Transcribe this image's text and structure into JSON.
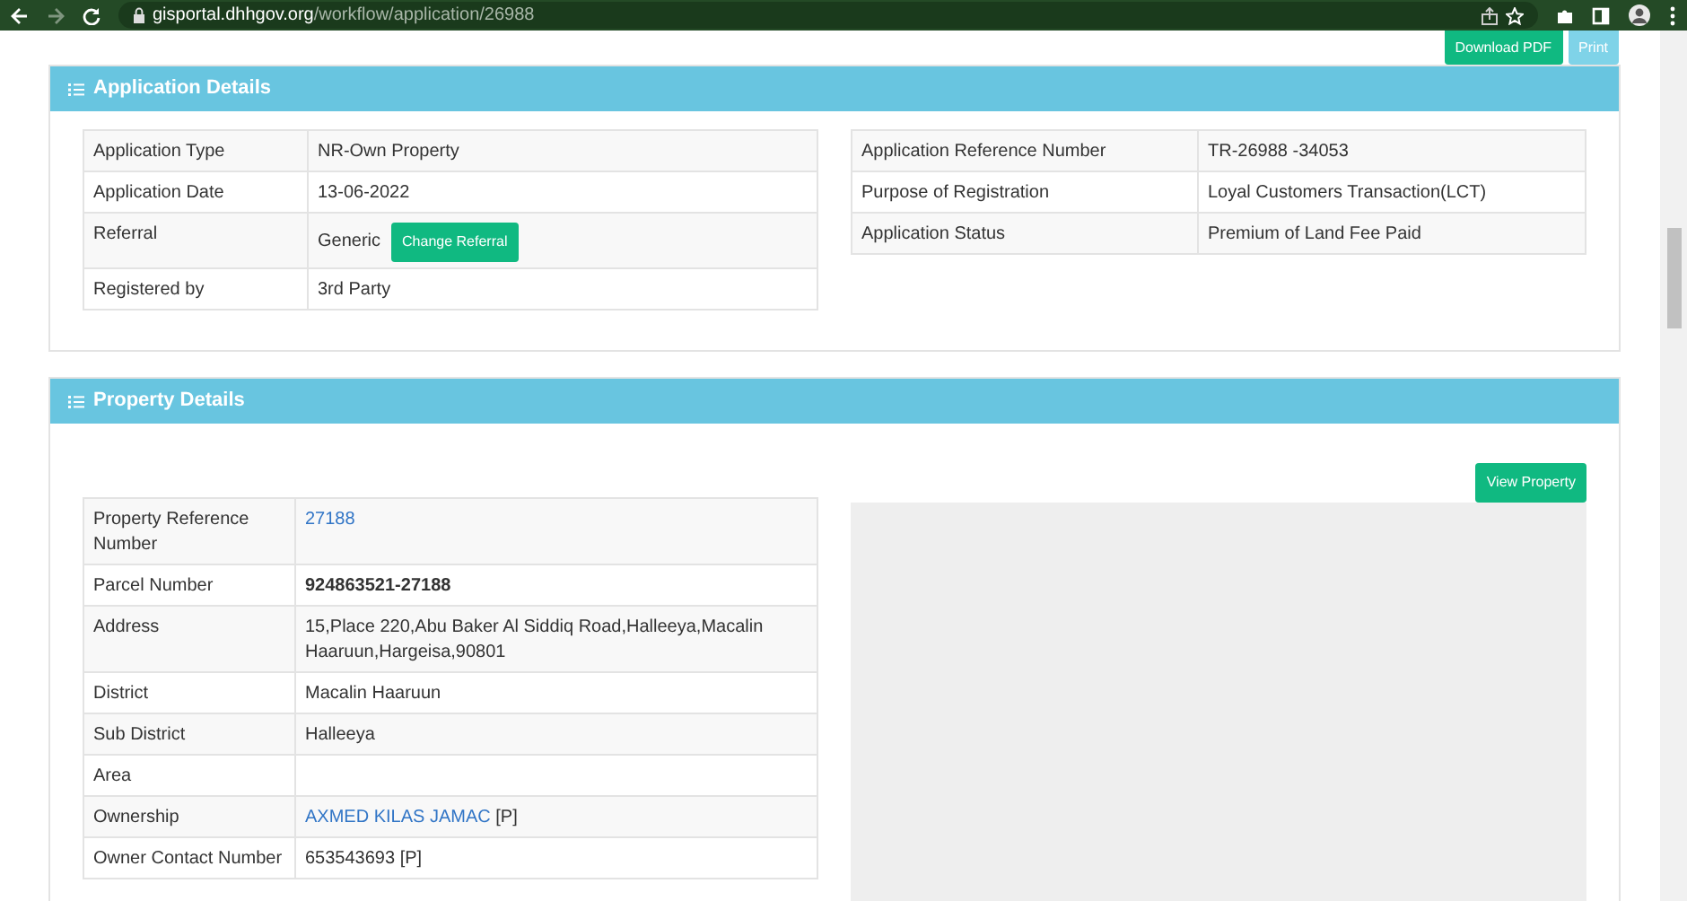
{
  "browser": {
    "url_host": "gisportal.dhhgov.org",
    "url_path": "/workflow/application/26988",
    "forward_disabled": true
  },
  "top_buttons": [
    {
      "label": "Download PDF",
      "kind": "success"
    },
    {
      "label": "Print",
      "kind": "info"
    }
  ],
  "application_details": {
    "title": "Application Details",
    "left_rows": [
      {
        "label": "Application Type",
        "value": "NR-Own Property"
      },
      {
        "label": "Application Date",
        "value": "13-06-2022"
      },
      {
        "label": "Referral",
        "value": "Generic",
        "button": "Change Referral"
      },
      {
        "label": "Registered by",
        "value": "3rd Party"
      }
    ],
    "right_rows": [
      {
        "label": "Application Reference Number",
        "value": "TR-26988 -34053"
      },
      {
        "label": "Purpose of Registration",
        "value": "Loyal Customers Transaction(LCT)"
      },
      {
        "label": "Application Status",
        "value": "Premium of Land Fee Paid"
      }
    ]
  },
  "property_details": {
    "title": "Property Details",
    "button": "View Property",
    "rows": [
      {
        "label": "Property Reference Number",
        "value": "27188",
        "kind": "link"
      },
      {
        "label": "Parcel Number",
        "value": "924863521-27188",
        "kind": "bold"
      },
      {
        "label": "Address",
        "value": "15,Place 220,Abu Baker Al Siddiq Road,Halleeya,Macalin Haaruun,Hargeisa,90801"
      },
      {
        "label": "District",
        "value": "Macalin Haaruun"
      },
      {
        "label": "Sub District",
        "value": "Halleeya"
      },
      {
        "label": "Area"
      },
      {
        "label": "Ownership",
        "value": "AXMED KILAS JAMAC",
        "kind": "link",
        "suffix": "[P]"
      },
      {
        "label": "Owner Contact Number",
        "value": "653543693",
        "suffix": "[P]"
      }
    ]
  }
}
